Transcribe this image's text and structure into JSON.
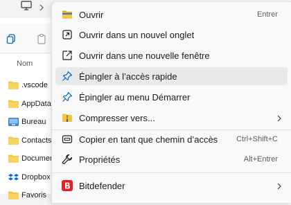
{
  "explorer": {
    "column_header": "Nom",
    "files": [
      {
        "name": ".vscode",
        "icon": "folder-icon"
      },
      {
        "name": "AppData",
        "icon": "folder-icon"
      },
      {
        "name": "Bureau",
        "icon": "desktop-folder-icon"
      },
      {
        "name": "Contacts",
        "icon": "folder-icon"
      },
      {
        "name": "Documents",
        "icon": "folder-icon"
      },
      {
        "name": "Dropbox",
        "icon": "dropbox-icon"
      },
      {
        "name": "Favoris",
        "icon": "folder-icon"
      }
    ]
  },
  "menu": {
    "items": [
      {
        "label": "Ouvrir",
        "shortcut": "Entrer",
        "icon": "folder-open-icon"
      },
      {
        "label": "Ouvrir dans un nouvel onglet",
        "shortcut": "",
        "icon": "new-tab-icon"
      },
      {
        "label": "Ouvrir dans une nouvelle fenêtre",
        "shortcut": "",
        "icon": "new-window-icon"
      },
      {
        "label": "Épingler à l’accès rapide",
        "shortcut": "",
        "icon": "pin-icon"
      },
      {
        "label": "Épingler au menu Démarrer",
        "shortcut": "",
        "icon": "pin-icon"
      },
      {
        "label": "Compresser vers...",
        "shortcut": "",
        "icon": "zip-folder-icon"
      },
      {
        "label": "Copier en tant que chemin d’accès",
        "shortcut": "Ctrl+Shift+C",
        "icon": "copy-path-icon"
      },
      {
        "label": "Propriétés",
        "shortcut": "Alt+Entrer",
        "icon": "wrench-icon"
      },
      {
        "label": "Bitdefender",
        "shortcut": "",
        "icon": "bitdefender-icon"
      }
    ]
  },
  "colors": {
    "accent": "#0067c0",
    "folder": "#f4c542",
    "bitdefender": "#ed1c24",
    "hover_bg": "#e9e9e9"
  }
}
